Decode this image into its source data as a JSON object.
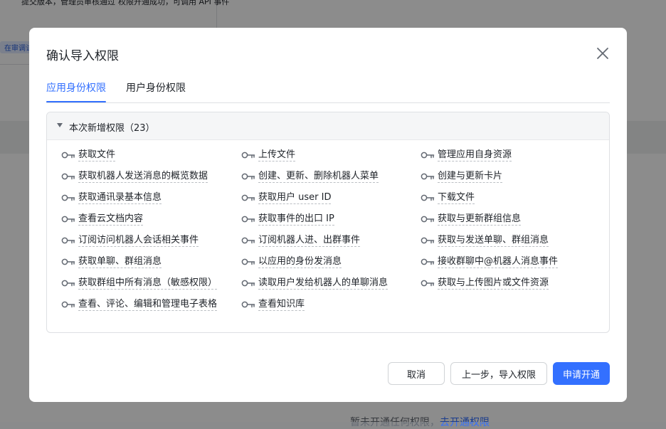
{
  "background": {
    "top_text_left": "提交版本，管理员审核通过",
    "top_text_right": "权限开通成功，可调用 API 事件",
    "badge": "在审调试",
    "bottom_text": "暂未开通任何权限，",
    "bottom_link": "去开通权限"
  },
  "dialog": {
    "title": "确认导入权限",
    "close_icon": "close-icon"
  },
  "tabs": [
    {
      "label": "应用身份权限",
      "active": true
    },
    {
      "label": "用户身份权限",
      "active": false
    }
  ],
  "section": {
    "title": "本次新增权限（23）",
    "expanded": true
  },
  "permissions": [
    [
      "获取文件",
      "上传文件",
      "管理应用自身资源"
    ],
    [
      "获取机器人发送消息的概览数据",
      "创建、更新、删除机器人菜单",
      "创建与更新卡片"
    ],
    [
      "获取通讯录基本信息",
      "获取用户 user ID",
      "下载文件"
    ],
    [
      "查看云文档内容",
      "获取事件的出口 IP",
      "获取与更新群组信息"
    ],
    [
      "订阅访问机器人会话相关事件",
      "订阅机器人进、出群事件",
      "获取与发送单聊、群组消息"
    ],
    [
      "获取单聊、群组消息",
      "以应用的身份发消息",
      "接收群聊中@机器人消息事件"
    ],
    [
      "获取群组中所有消息（敏感权限）",
      "读取用户发给机器人的单聊消息",
      "获取与上传图片或文件资源"
    ],
    [
      "查看、评论、编辑和管理电子表格",
      "查看知识库"
    ]
  ],
  "buttons": {
    "cancel": "取消",
    "back": "上一步，导入权限",
    "apply": "申请开通"
  },
  "colors": {
    "accent": "#3370ff",
    "text": "#1f2329",
    "border": "#dee0e3"
  }
}
